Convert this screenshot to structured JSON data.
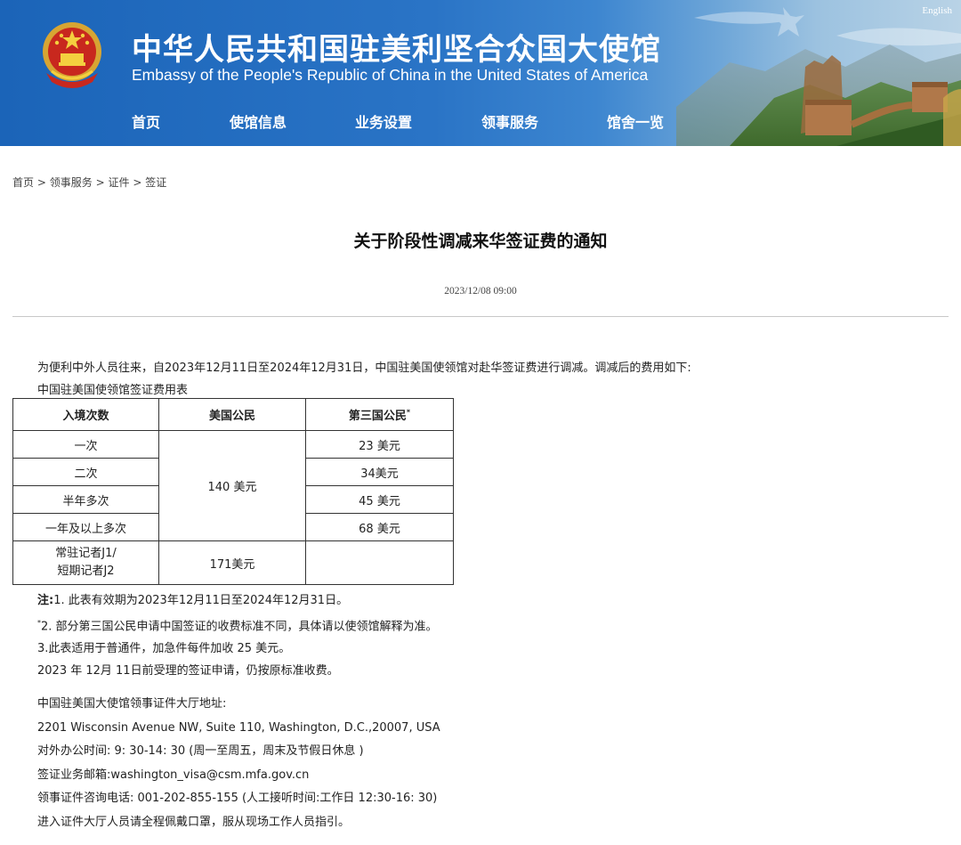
{
  "header": {
    "title_cn": "中华人民共和国驻美利坚合众国大使馆",
    "title_en": "Embassy of the People's Republic of China in the United States of America",
    "english_link": "English"
  },
  "nav": {
    "items": [
      {
        "label": "首页"
      },
      {
        "label": "使馆信息"
      },
      {
        "label": "业务设置"
      },
      {
        "label": "领事服务"
      },
      {
        "label": "馆舍一览"
      }
    ]
  },
  "breadcrumb": {
    "items": [
      "首页",
      "领事服务",
      "证件",
      "签证"
    ],
    "separator": ">"
  },
  "article": {
    "title": "关于阶段性调减来华签证费的通知",
    "date": "2023/12/08 09:00",
    "intro": "为便利中外人员往来，自2023年12月11日至2024年12月31日，中国驻美国使领馆对赴华签证费进行调减。调减后的费用如下:",
    "table_caption": "中国驻美国使领馆签证费用表"
  },
  "fee_table": {
    "headers": [
      "入境次数",
      "美国公民",
      "第三国公民"
    ],
    "header_mark": "*",
    "rows": [
      {
        "entry": "一次",
        "third": "23 美元"
      },
      {
        "entry": "二次",
        "third": "34美元"
      },
      {
        "entry": "半年多次",
        "third": "45 美元"
      },
      {
        "entry": "一年及以上多次",
        "third": "68 美元"
      }
    ],
    "us_fee": "140 美元",
    "journalist_line1": "常驻记者J1/",
    "journalist_line2": "短期记者J2",
    "journalist_fee": "171美元",
    "journalist_third": ""
  },
  "notes": {
    "label": "注:",
    "note1": "1. 此表有效期为2023年12月11日至2024年12月31日。",
    "note2_mark": "*",
    "note2": "2. 部分第三国公民申请中国签证的收费标准不同，具体请以使领馆解释为准。",
    "note3": "3.此表适用于普通件，加急件每件加收 25 美元。",
    "note4": "2023 年 12月 11日前受理的签证申请，仍按原标准收费。"
  },
  "contact": {
    "hall_label": "中国驻美国大使馆领事证件大厅地址:",
    "address": "2201 Wisconsin Avenue NW, Suite 110, Washington, D.C.,20007, USA",
    "hours": "对外办公时间: 9: 30-14: 30 (周一至周五，周末及节假日休息 )",
    "email": "签证业务邮箱:washington_visa@csm.mfa.gov.cn",
    "phone": "领事证件咨询电话: 001-202-855-155 (人工接听时间:工作日 12:30-16: 30)",
    "mask_notice": "进入证件大厅人员请全程佩戴口罩，服从现场工作人员指引。"
  }
}
